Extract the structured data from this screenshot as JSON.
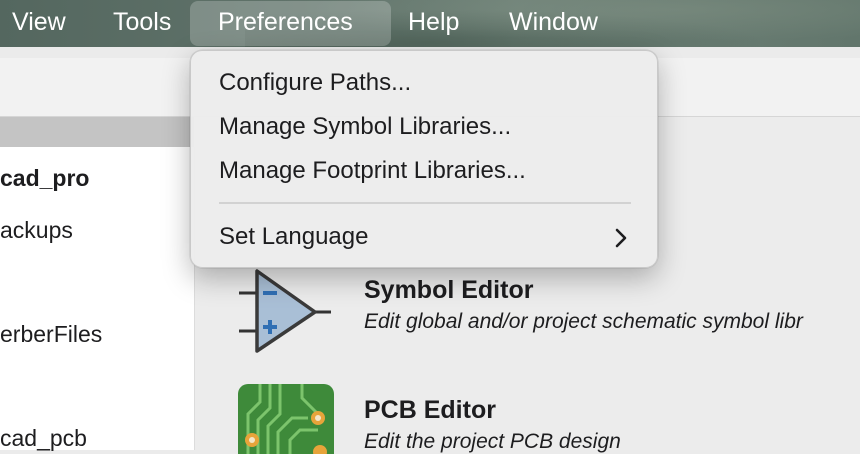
{
  "menubar": {
    "items": [
      "View",
      "Tools",
      "Preferences",
      "Help",
      "Window"
    ],
    "active": "Preferences"
  },
  "preferences_menu": {
    "items": [
      {
        "label": "Configure Paths..."
      },
      {
        "label": "Manage Symbol Libraries..."
      },
      {
        "label": "Manage Footprint Libraries..."
      },
      {
        "label": "Set Language",
        "submenu": true
      }
    ]
  },
  "project_tree": {
    "items": [
      "cad_pro",
      "ackups",
      "erberFiles",
      "cad_pcb"
    ]
  },
  "tools": [
    {
      "title": "Symbol Editor",
      "description": "Edit global and/or project schematic symbol libr",
      "icon": "symbol-editor-icon"
    },
    {
      "title": "PCB Editor",
      "description": "Edit the project PCB design",
      "icon": "pcb-editor-icon"
    }
  ],
  "colors": {
    "menubar_bg": "#60736a",
    "dropdown_bg": "#ececec",
    "panel_bg": "#ececec",
    "pcb_green": "#3e8a3a",
    "pcb_pad": "#e7a43a",
    "opamp_fill": "#a9bfd6"
  }
}
